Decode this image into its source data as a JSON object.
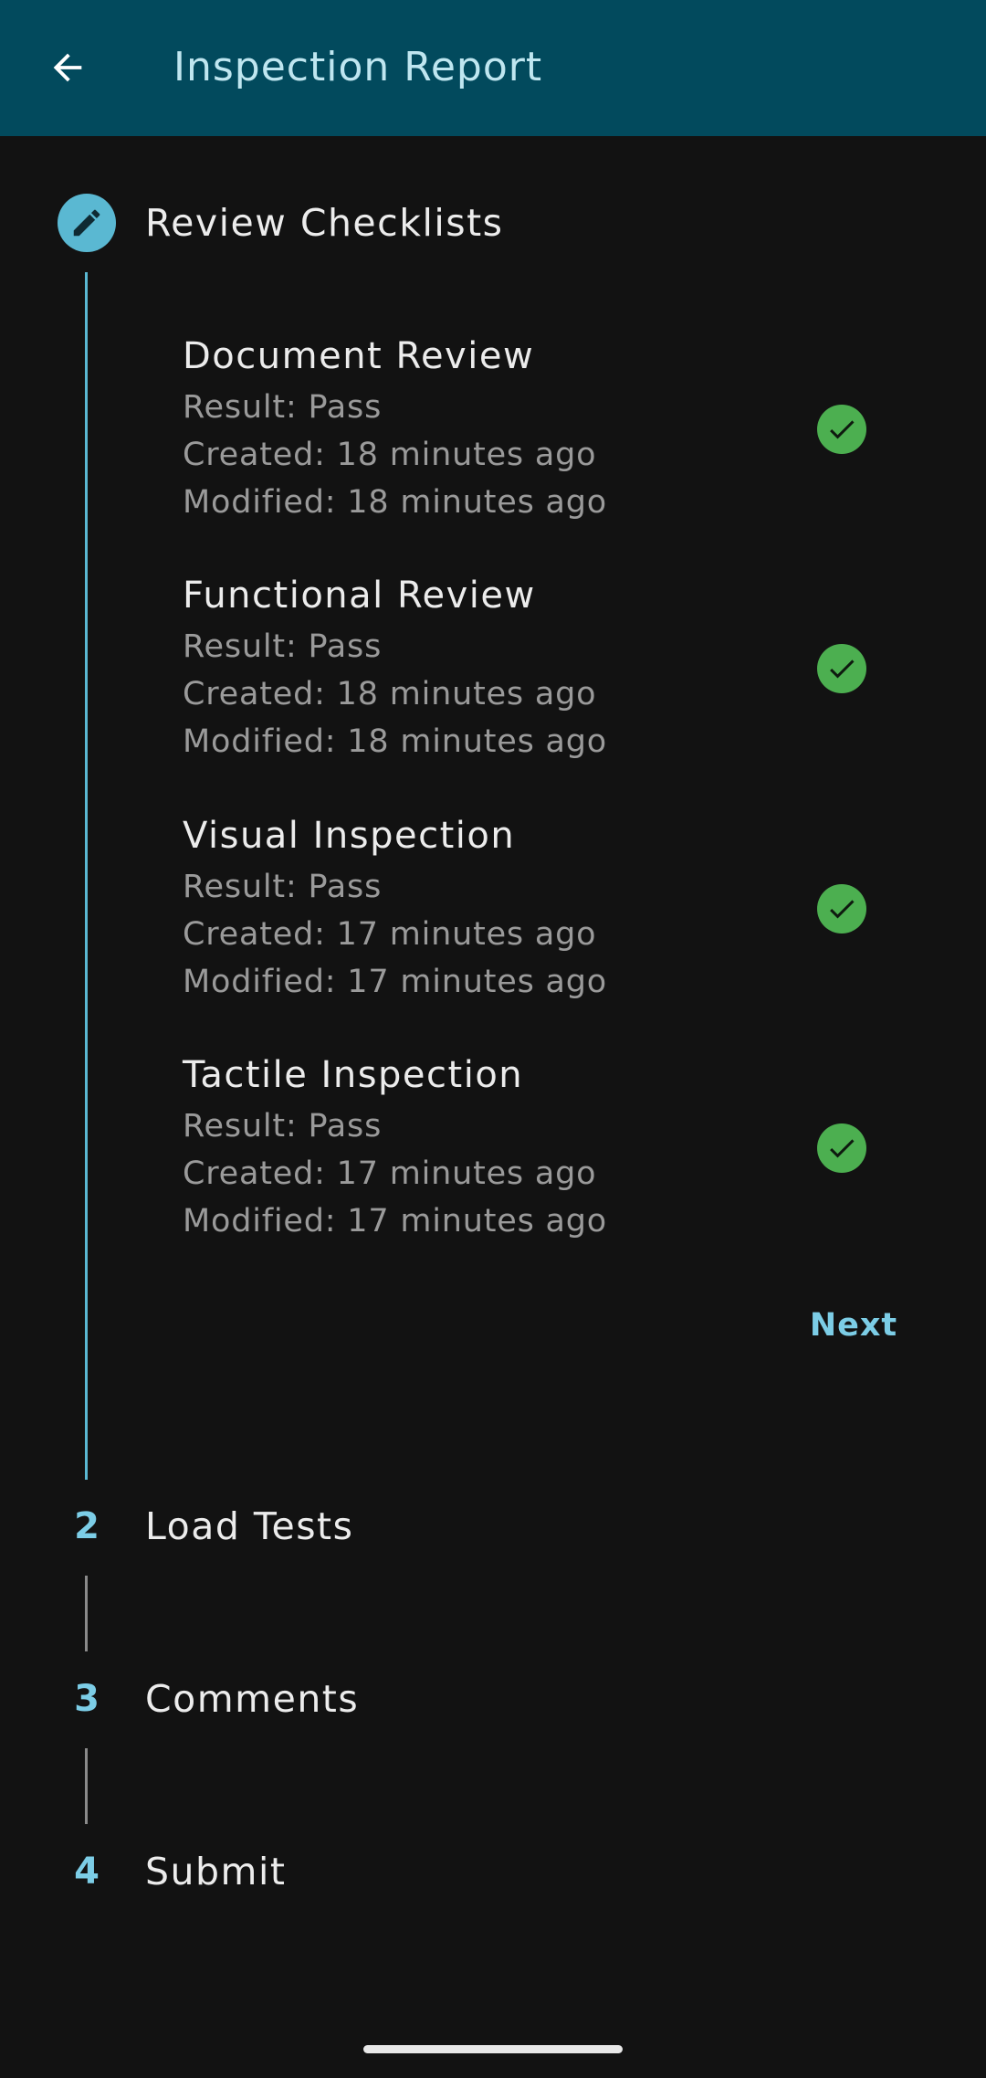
{
  "app_bar": {
    "title": "Inspection Report",
    "back_icon": "arrow-left-icon",
    "color": "#024A5D"
  },
  "stepper": {
    "active_step": {
      "title": "Review Checklists",
      "icon": "pencil-icon",
      "accent": "#5AB8D2",
      "items": [
        {
          "title": "Document Review",
          "result": "Result: Pass",
          "created": "Created: 18 minutes ago",
          "modified": "Modified: 18 minutes ago",
          "status_icon": "check-circle-icon"
        },
        {
          "title": "Functional Review",
          "result": "Result: Pass",
          "created": "Created: 18 minutes ago",
          "modified": "Modified: 18 minutes ago",
          "status_icon": "check-circle-icon"
        },
        {
          "title": "Visual Inspection",
          "result": "Result: Pass",
          "created": "Created: 17 minutes ago",
          "modified": "Modified: 17 minutes ago",
          "status_icon": "check-circle-icon"
        },
        {
          "title": "Tactile Inspection",
          "result": "Result: Pass",
          "created": "Created: 17 minutes ago",
          "modified": "Modified: 17 minutes ago",
          "status_icon": "check-circle-icon"
        }
      ],
      "next_label": "Next"
    },
    "steps": [
      {
        "number": "2",
        "title": "Load Tests"
      },
      {
        "number": "3",
        "title": "Comments"
      },
      {
        "number": "4",
        "title": "Submit"
      }
    ]
  }
}
